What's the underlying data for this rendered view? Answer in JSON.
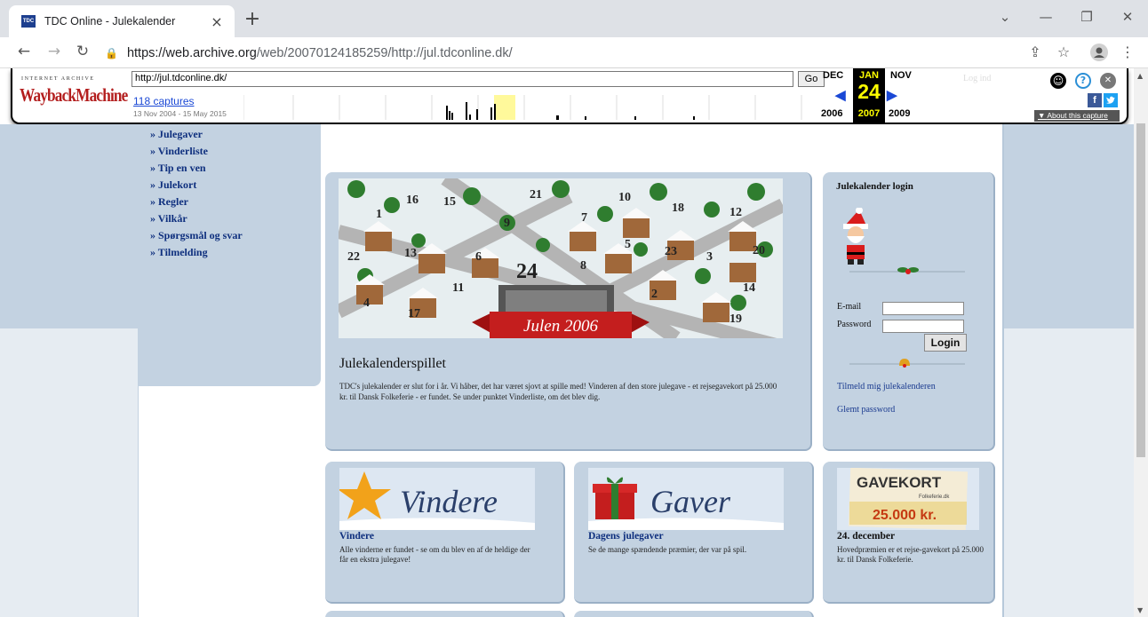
{
  "browser": {
    "tab_title": "TDC Online - Julekalender",
    "favicon_text": "TDC",
    "url_prefix": "https://web.archive.org",
    "url_rest": "/web/20070124185259/http://jul.tdconline.dk/"
  },
  "wayback": {
    "logo_top": "INTERNET ARCHIVE",
    "logo": "WaybackMachine",
    "url_input": "http://jul.tdconline.dk/",
    "go": "Go",
    "captures": "118 captures",
    "range": "13 Nov 2004 - 15 May 2015",
    "prev_month": "DEC",
    "cur_month": "JAN",
    "next_month": "NOV",
    "day": "24",
    "prev_year": "2006",
    "cur_year": "2007",
    "next_year": "2009",
    "login": "Log ind",
    "facebook": "f",
    "about": "About this capture"
  },
  "nav": [
    "» Julegaver",
    "» Vinderliste",
    "» Tip en ven",
    "» Julekort",
    "» Regler",
    "» Vilkår",
    "» Spørgsmål og svar",
    "» Tilmelding"
  ],
  "main": {
    "banner": "Julen 2006",
    "title": "Julekalenderspillet",
    "text": "TDC's julekalender er slut for i år. Vi håber, det har været sjovt at spille med! Vinderen af den store julegave - et rejsegavekort på 25.000 kr. til Dansk Folkeferie - er fundet. Se under punktet Vinderliste, om det blev dig."
  },
  "login": {
    "title": "Julekalender login",
    "email_label": "E-mail",
    "password_label": "Password",
    "button": "Login",
    "register_link": "Tilmeld mig julekalenderen",
    "forgot_link": "Glemt password"
  },
  "boxes": [
    {
      "image_text": "Vindere",
      "title": "Vindere",
      "text": "Alle vinderne er fundet - se om du blev en af de heldige der får en ekstra julegave!"
    },
    {
      "image_text": "Gaver",
      "title": "Dagens julegaver",
      "text": "Se de mange spændende præmier, der var på spil."
    },
    {
      "image_text": "GAVEKORT",
      "image_sub": "25.000 kr.",
      "image_brand": "Folkeferie.dk",
      "title": "24. december",
      "text": "Hovedpræmien er et rejse-gavekort på 25.000 kr. til Dansk Folkeferie."
    }
  ],
  "calendar_numbers": [
    "16",
    "15",
    "21",
    "10",
    "18",
    "12",
    "1",
    "9",
    "7",
    "22",
    "13",
    "6",
    "24",
    "8",
    "5",
    "23",
    "3",
    "20",
    "11",
    "2",
    "14",
    "4",
    "17",
    "19"
  ]
}
